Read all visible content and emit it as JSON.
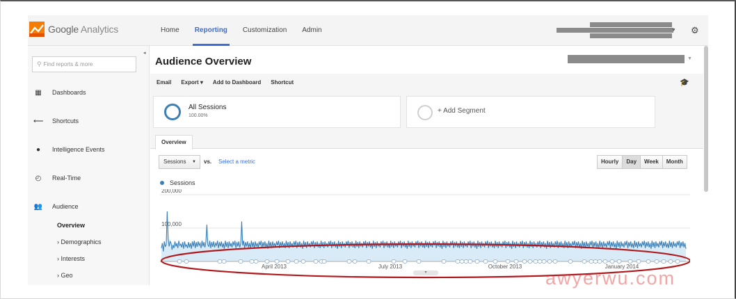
{
  "header": {
    "brand": "Google Analytics",
    "brand_part1": "Google",
    "brand_part2": "Analytics",
    "nav": [
      "Home",
      "Reporting",
      "Customization",
      "Admin"
    ],
    "active_nav": "Reporting"
  },
  "sidebar": {
    "search_placeholder": "Find reports & more",
    "items": [
      {
        "label": "Dashboards",
        "icon": "grid-icon"
      },
      {
        "label": "Shortcuts",
        "icon": "arrow-left-icon"
      },
      {
        "label": "Intelligence Events",
        "icon": "bulb-icon"
      },
      {
        "label": "Real-Time",
        "icon": "clock-icon"
      },
      {
        "label": "Audience",
        "icon": "people-icon"
      }
    ],
    "subitems": [
      "Overview",
      "› Demographics",
      "› Interests",
      "› Geo"
    ]
  },
  "main": {
    "title": "Audience Overview",
    "toolbar": [
      "Email",
      "Export ▾",
      "Add to Dashboard",
      "Shortcut"
    ],
    "segment": {
      "title": "All Sessions",
      "subtitle": "100.00%"
    },
    "add_segment": "+ Add Segment",
    "tab": "Overview",
    "metric": "Sessions",
    "vs": "vs.",
    "select_metric": "Select a metric",
    "granularity": [
      "Hourly",
      "Day",
      "Week",
      "Month"
    ],
    "active_granularity": "Day",
    "legend": "Sessions"
  },
  "colors": {
    "accent": "#3a6fd8",
    "series": "#3b7fb6",
    "fill": "#cfe6f5",
    "annotation_ellipse": "#b0191d"
  },
  "chart_data": {
    "type": "area",
    "series": [
      {
        "name": "Sessions",
        "values": [
          40000,
          55000,
          30000,
          60000,
          45000,
          50000,
          150000,
          70000,
          45000,
          60000,
          55000,
          35000,
          50000,
          40000,
          60000,
          45000,
          55000,
          40000,
          62000,
          48000,
          52000,
          42000,
          58000,
          38000,
          60000,
          45000,
          50000,
          40000,
          58000,
          42000,
          55000,
          38000,
          60000,
          45000,
          62000,
          40000,
          58000,
          44000,
          60000,
          48000,
          55000,
          40000,
          62000,
          45000,
          58000,
          42000,
          60000,
          110000,
          50000,
          45000,
          62000,
          40000,
          58000,
          44000,
          60000,
          42000,
          55000,
          48000,
          62000,
          40000,
          58000,
          45000,
          60000,
          42000,
          55000,
          38000,
          62000,
          44000,
          58000,
          40000,
          60000,
          45000,
          55000,
          42000,
          60000,
          48000,
          62000,
          40000,
          58000,
          45000,
          60000,
          42000,
          55000,
          120000,
          48000,
          62000,
          40000,
          58000,
          45000,
          60000,
          42000,
          55000,
          40000,
          62000,
          44000,
          58000,
          40000,
          60000,
          45000,
          55000,
          42000,
          60000,
          48000,
          62000,
          40000,
          58000,
          45000,
          60000,
          42000,
          55000,
          38000,
          62000,
          44000,
          58000,
          40000,
          60000,
          45000,
          55000,
          42000,
          60000,
          48000,
          62000,
          40000,
          58000,
          45000,
          60000,
          42000,
          55000,
          40000,
          62000,
          44000,
          58000,
          40000,
          60000,
          45000,
          55000,
          42000,
          60000,
          48000,
          62000,
          40000,
          58000,
          45000,
          60000,
          42000,
          55000,
          38000,
          62000,
          44000,
          58000,
          40000,
          60000,
          45000,
          55000,
          42000,
          60000,
          48000,
          62000,
          40000,
          58000,
          45000,
          60000,
          42000,
          55000,
          40000,
          62000,
          44000,
          58000,
          40000,
          60000,
          45000,
          55000,
          42000,
          60000,
          48000,
          62000,
          40000,
          58000,
          45000,
          60000,
          42000,
          55000,
          38000,
          62000,
          44000,
          58000,
          40000,
          60000,
          45000,
          55000,
          42000,
          60000,
          48000,
          62000,
          40000,
          58000,
          45000,
          60000,
          42000,
          55000,
          40000,
          62000,
          44000,
          58000,
          40000,
          60000,
          45000,
          55000,
          42000,
          60000,
          48000,
          62000,
          40000,
          58000,
          45000,
          60000,
          42000,
          55000,
          38000,
          62000,
          44000,
          58000,
          40000,
          60000,
          45000,
          55000,
          42000,
          60000,
          48000,
          62000,
          40000,
          58000,
          45000,
          60000,
          42000,
          55000,
          40000,
          62000,
          44000,
          58000,
          40000,
          60000,
          45000,
          55000,
          42000,
          60000,
          48000,
          62000,
          40000,
          58000,
          45000,
          60000,
          42000,
          55000,
          38000,
          62000,
          44000,
          58000,
          40000,
          60000,
          45000,
          55000,
          42000,
          60000,
          48000,
          62000,
          40000,
          58000,
          45000,
          60000,
          42000,
          55000,
          40000,
          62000,
          44000,
          58000,
          40000,
          60000,
          45000,
          55000,
          42000,
          60000,
          48000,
          62000,
          40000,
          58000,
          45000,
          60000,
          42000,
          55000,
          38000,
          62000,
          44000,
          58000,
          40000,
          60000,
          45000,
          55000,
          42000,
          60000,
          48000,
          62000,
          40000,
          58000,
          45000,
          60000,
          42000,
          55000,
          40000,
          62000,
          44000,
          58000,
          40000,
          60000,
          45000,
          55000,
          42000,
          60000,
          48000,
          62000,
          40000,
          58000,
          45000,
          60000,
          42000,
          55000,
          38000,
          62000,
          44000,
          58000,
          40000,
          60000,
          45000,
          55000,
          42000,
          60000,
          48000,
          62000,
          40000,
          58000,
          45000,
          60000,
          42000,
          55000,
          40000,
          62000,
          44000,
          58000,
          40000,
          60000,
          45000,
          55000,
          42000,
          60000,
          48000,
          62000,
          40000,
          58000,
          45000,
          60000,
          42000,
          55000,
          38000,
          62000,
          44000,
          58000,
          40000,
          60000,
          45000,
          55000,
          42000,
          60000,
          48000,
          62000,
          40000,
          58000,
          45000,
          60000,
          42000,
          55000,
          40000,
          62000,
          44000,
          58000,
          40000,
          60000,
          45000,
          55000,
          42000,
          60000,
          48000,
          62000,
          40000,
          58000,
          45000,
          60000,
          42000,
          55000,
          38000,
          62000,
          44000,
          58000,
          40000,
          60000,
          45000,
          55000,
          42000,
          60000,
          48000,
          62000,
          40000,
          58000,
          45000,
          60000,
          42000,
          55000,
          40000,
          62000,
          44000,
          58000,
          40000,
          60000,
          45000,
          55000,
          42000,
          60000,
          48000,
          62000,
          40000,
          58000,
          45000,
          60000,
          42000,
          55000,
          38000,
          62000,
          44000,
          58000,
          40000,
          60000,
          45000,
          55000,
          42000,
          60000,
          48000,
          62000,
          40000,
          58000,
          45000,
          60000,
          42000,
          55000,
          40000,
          62000,
          44000,
          58000,
          40000,
          60000,
          45000,
          55000,
          42000,
          60000,
          48000,
          62000,
          40000,
          58000,
          45000,
          60000,
          42000,
          55000,
          38000,
          62000,
          44000,
          58000,
          40000,
          60000,
          45000,
          55000,
          42000,
          60000,
          48000,
          62000,
          40000,
          58000,
          45000,
          60000,
          42000,
          55000,
          40000,
          62000,
          44000,
          58000,
          40000,
          60000,
          45000,
          55000,
          42000,
          60000,
          48000,
          62000,
          40000,
          58000,
          45000,
          60000,
          42000,
          55000,
          38000,
          62000,
          44000,
          58000,
          40000,
          60000,
          45000,
          55000,
          42000,
          60000,
          48000,
          62000,
          40000,
          58000,
          45000,
          60000,
          42000,
          55000,
          40000,
          62000,
          44000,
          58000,
          40000,
          60000,
          45000,
          55000,
          42000,
          60000,
          48000,
          62000,
          40000,
          58000,
          45000,
          60000,
          42000,
          55000,
          38000
        ]
      }
    ],
    "y_ticks": [
      "200,000",
      "100,000"
    ],
    "ylim": [
      0,
      200000
    ],
    "x_ticks": [
      "April 2013",
      "July 2013",
      "October 2013",
      "January 2014"
    ],
    "grid": true,
    "legend_position": "top-left"
  },
  "watermark": "awyerwu.com"
}
